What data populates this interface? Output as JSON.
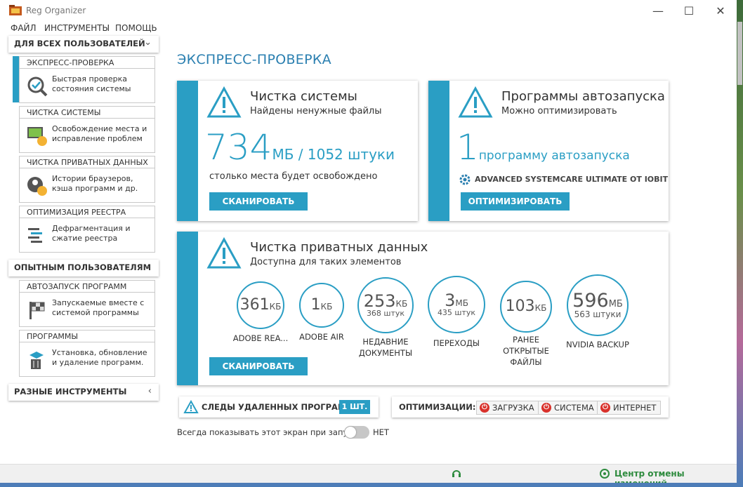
{
  "window": {
    "title": "Reg Organizer"
  },
  "menu": [
    "ФАЙЛ",
    "ИНСТРУМЕНТЫ",
    "ПОМОЩЬ"
  ],
  "sidebar": {
    "groups": [
      {
        "label": "ДЛЯ ВСЕХ ПОЛЬЗОВАТЕЛЕЙ",
        "icon": "chevron-down-icon"
      },
      {
        "label": "ОПЫТНЫМ ПОЛЬЗОВАТЕЛЯМ",
        "icon": "chevron-down-icon"
      },
      {
        "label": "РАЗНЫЕ ИНСТРУМЕНТЫ",
        "icon": "chevron-left-icon"
      }
    ],
    "cards": [
      {
        "title": "ЭКСПРЕСС-ПРОВЕРКА",
        "line1": "Быстрая проверка",
        "line2": "состояния системы",
        "icon": "magnifier-check-icon"
      },
      {
        "title": "ЧИСТКА СИСТЕМЫ",
        "line1": "Освобождение места и",
        "line2": "исправление проблем",
        "icon": "cleanup-icon"
      },
      {
        "title": "ЧИСТКА ПРИВАТНЫХ ДАННЫХ",
        "line1": "Истории браузеров,",
        "line2": "кэша программ и др.",
        "icon": "privacy-icon"
      },
      {
        "title": "ОПТИМИЗАЦИЯ РЕЕСТРА",
        "line1": "Дефрагментация и",
        "line2": "сжатие реестра",
        "icon": "registry-icon"
      },
      {
        "title": "АВТОЗАПУСК ПРОГРАММ",
        "line1": "Запускаемые вместе с",
        "line2": "системой программы",
        "icon": "startup-flag-icon"
      },
      {
        "title": "ПРОГРАММЫ",
        "line1": "Установка, обновление",
        "line2": "и удаление программ.",
        "icon": "uninstall-icon"
      }
    ]
  },
  "page": {
    "title": "ЭКСПРЕСС-ПРОВЕРКА"
  },
  "system_clean": {
    "title": "Чистка системы",
    "subtitle": "Найдены ненужные файлы",
    "big": "734",
    "suffix": "МБ / 1052 штуки",
    "note": "столько места будет освобождено",
    "button": "СКАНИРОВАТЬ"
  },
  "autorun": {
    "title": "Программы автозапуска",
    "subtitle": "Можно оптимизировать",
    "big": "1",
    "suffix": "программу автозапуска",
    "program": "ADVANCED SYSTEMCARE ULTIMATE OT IOBIT",
    "button": "ОПТИМИЗИРОВАТЬ"
  },
  "privacy": {
    "title": "Чистка приватных данных",
    "subtitle": "Доступна для таких элементов",
    "button": "СКАНИРОВАТЬ",
    "items": [
      {
        "value": "361",
        "unit": "КБ",
        "count": "",
        "l1": "ADOBE REA...",
        "l2": "",
        "l3": ""
      },
      {
        "value": "1",
        "unit": "КБ",
        "count": "",
        "l1": "ADOBE AIR",
        "l2": "",
        "l3": ""
      },
      {
        "value": "253",
        "unit": "КБ",
        "count": "368 штук",
        "l1": "НЕДАВНИЕ",
        "l2": "ДОКУМЕНТЫ",
        "l3": ""
      },
      {
        "value": "3",
        "unit": "МБ",
        "count": "435 штук",
        "l1": "ПЕРЕХОДЫ",
        "l2": "",
        "l3": ""
      },
      {
        "value": "103",
        "unit": "КБ",
        "count": "",
        "l1": "РАНЕЕ",
        "l2": "ОТКРЫТЫЕ",
        "l3": "ФАЙЛЫ"
      },
      {
        "value": "596",
        "unit": "МБ",
        "count": "563 штуки",
        "l1": "NVIDIA BACKUP",
        "l2": "",
        "l3": ""
      }
    ]
  },
  "traces": {
    "label": "СЛЕДЫ УДАЛЕННЫХ ПРОГРАММ",
    "badge": "1 ШТ."
  },
  "optim": {
    "label": "ОПТИМИЗАЦИИ:",
    "chips": [
      "ЗАГРУЗКА",
      "СИСТЕМА",
      "ИНТЕРНЕТ"
    ]
  },
  "startup_toggle": {
    "label": "Всегда показывать этот экран при запуске",
    "state": "НЕТ"
  },
  "status": {
    "undo": "Центр отмены изменений"
  },
  "colors": {
    "accent": "#2a9ec4",
    "warning_red": "#d9312b",
    "link_green": "#2e8b3e"
  }
}
